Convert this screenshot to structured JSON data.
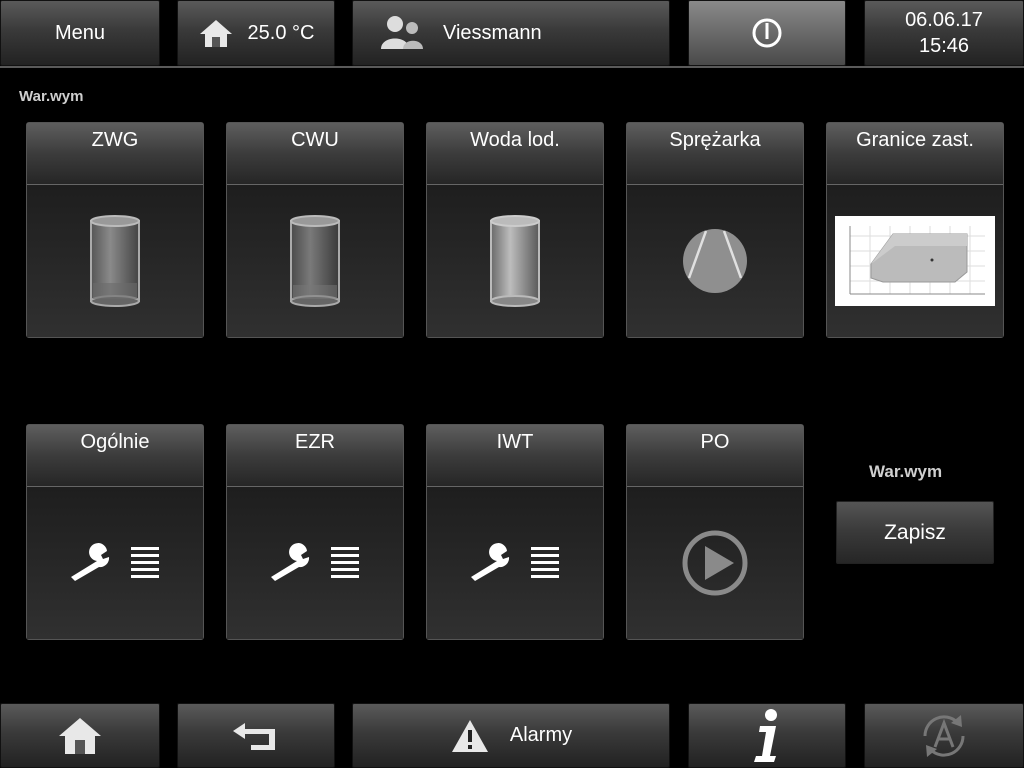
{
  "topbar": {
    "menu_label": "Menu",
    "temperature": "25.0 °C",
    "user_name": "Viessmann",
    "date": "06.06.17",
    "time": "15:46"
  },
  "section_label": "War.wym",
  "tiles": [
    {
      "label": "ZWG",
      "icon": "cylinder-tank-icon"
    },
    {
      "label": "CWU",
      "icon": "cylinder-tank-icon"
    },
    {
      "label": "Woda lod.",
      "icon": "cylinder-tank-icon"
    },
    {
      "label": "Sprężarka",
      "icon": "compressor-icon"
    },
    {
      "label": "Granice zast.",
      "icon": "envelope-chart-icon"
    },
    {
      "label": "Ogólnie",
      "icon": "wrench-list-icon"
    },
    {
      "label": "EZR",
      "icon": "wrench-list-icon"
    },
    {
      "label": "IWT",
      "icon": "wrench-list-icon"
    },
    {
      "label": "PO",
      "icon": "play-circle-icon"
    }
  ],
  "save_panel": {
    "label": "War.wym",
    "button_label": "Zapisz"
  },
  "bottombar": {
    "alarms_label": "Alarmy"
  }
}
